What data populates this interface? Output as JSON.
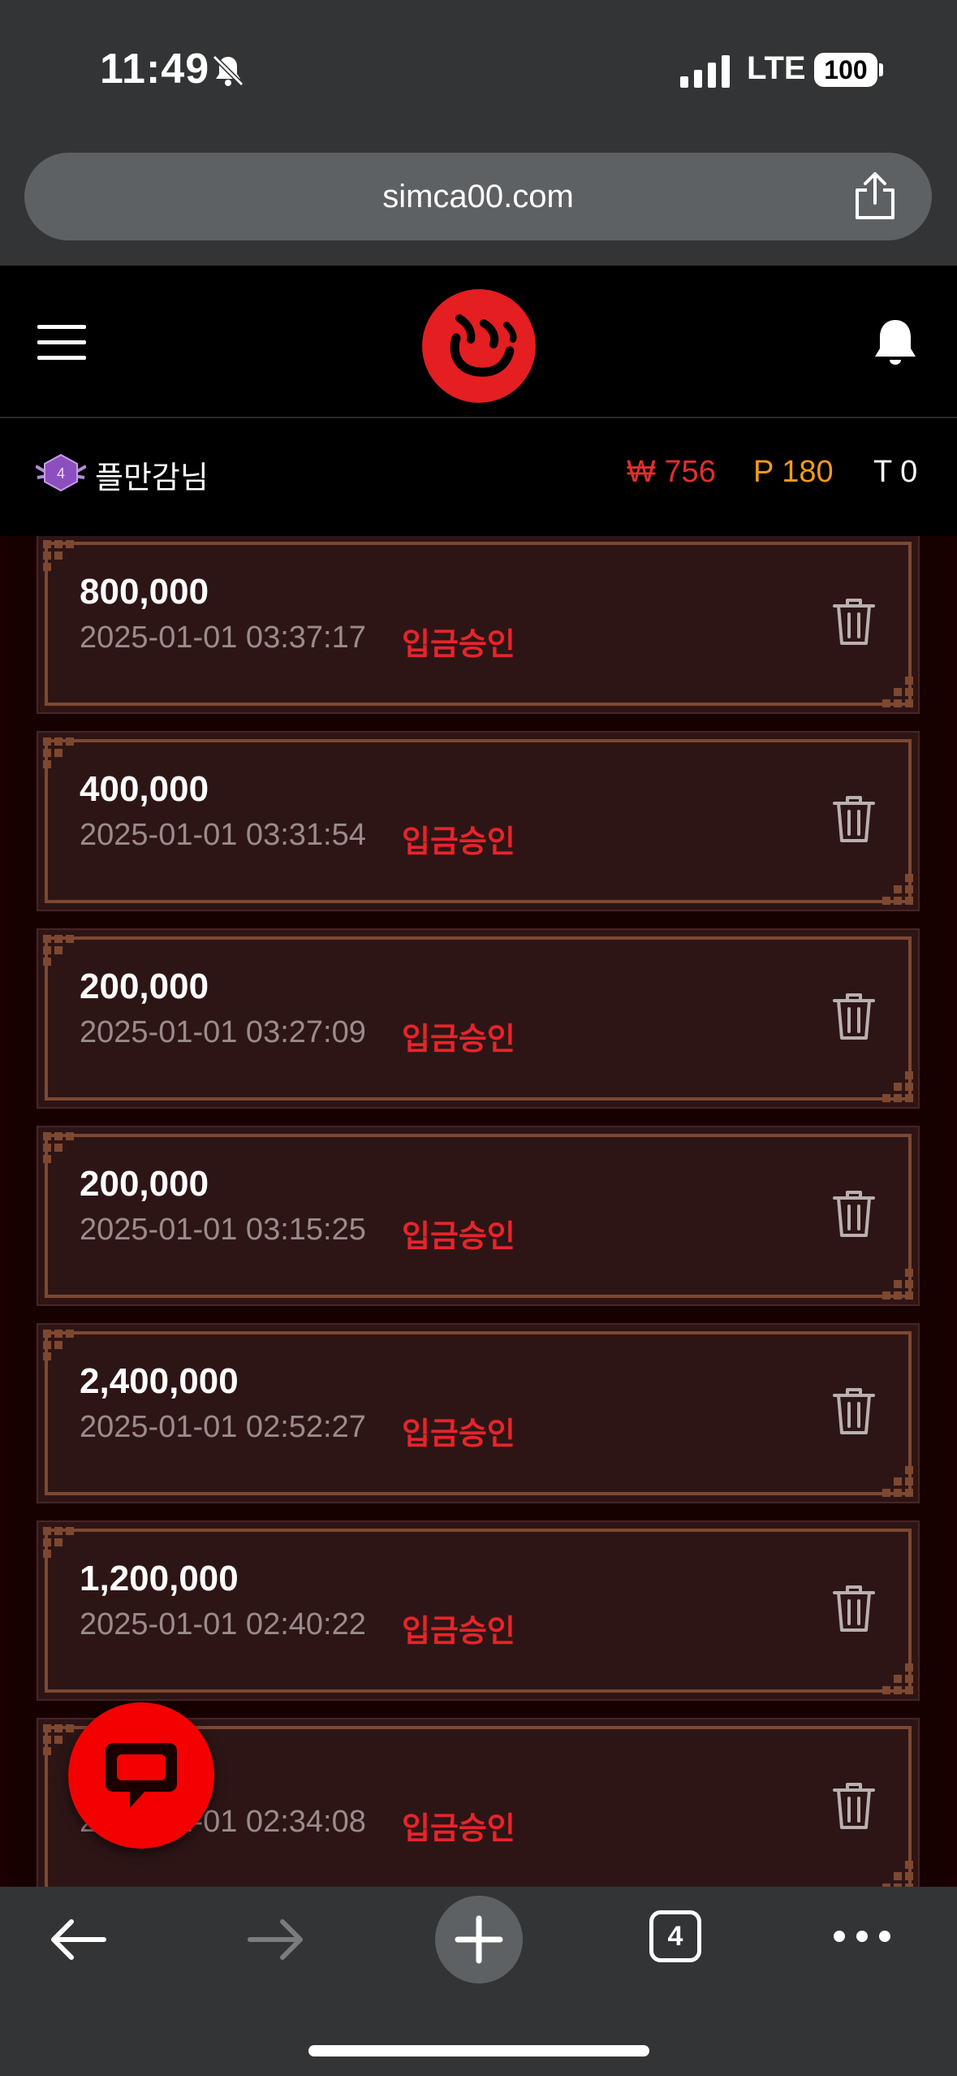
{
  "status_bar": {
    "time": "11:49",
    "network": "LTE",
    "battery": "100"
  },
  "browser": {
    "url": "simca00.com",
    "tab_count": "4"
  },
  "user": {
    "level": "4",
    "name": "플만감님",
    "money": "₩ 756",
    "points": "P 180",
    "tickets": "T 0"
  },
  "entries": [
    {
      "amount": "800,000",
      "timestamp": "2025-01-01 03:37:17",
      "status": "입금승인"
    },
    {
      "amount": "400,000",
      "timestamp": "2025-01-01 03:31:54",
      "status": "입금승인"
    },
    {
      "amount": "200,000",
      "timestamp": "2025-01-01 03:27:09",
      "status": "입금승인"
    },
    {
      "amount": "200,000",
      "timestamp": "2025-01-01 03:15:25",
      "status": "입금승인"
    },
    {
      "amount": "2,400,000",
      "timestamp": "2025-01-01 02:52:27",
      "status": "입금승인"
    },
    {
      "amount": "1,200,000",
      "timestamp": "2025-01-01 02:40:22",
      "status": "입금승인"
    },
    {
      "amount": "",
      "timestamp": "2025-01-01 02:34:08",
      "status": "입금승인"
    }
  ],
  "colors": {
    "accent_red": "#e8242a",
    "points_orange": "#f39a1e",
    "card_bg": "#2d1516"
  },
  "icons": [
    "bell-slash-icon",
    "signal-icon",
    "share-icon",
    "menu-icon",
    "logo",
    "bell-icon",
    "level-badge-icon",
    "trash-icon",
    "chat-icon",
    "back-arrow-icon",
    "forward-arrow-icon",
    "plus-icon",
    "tabs-icon",
    "more-icon"
  ]
}
